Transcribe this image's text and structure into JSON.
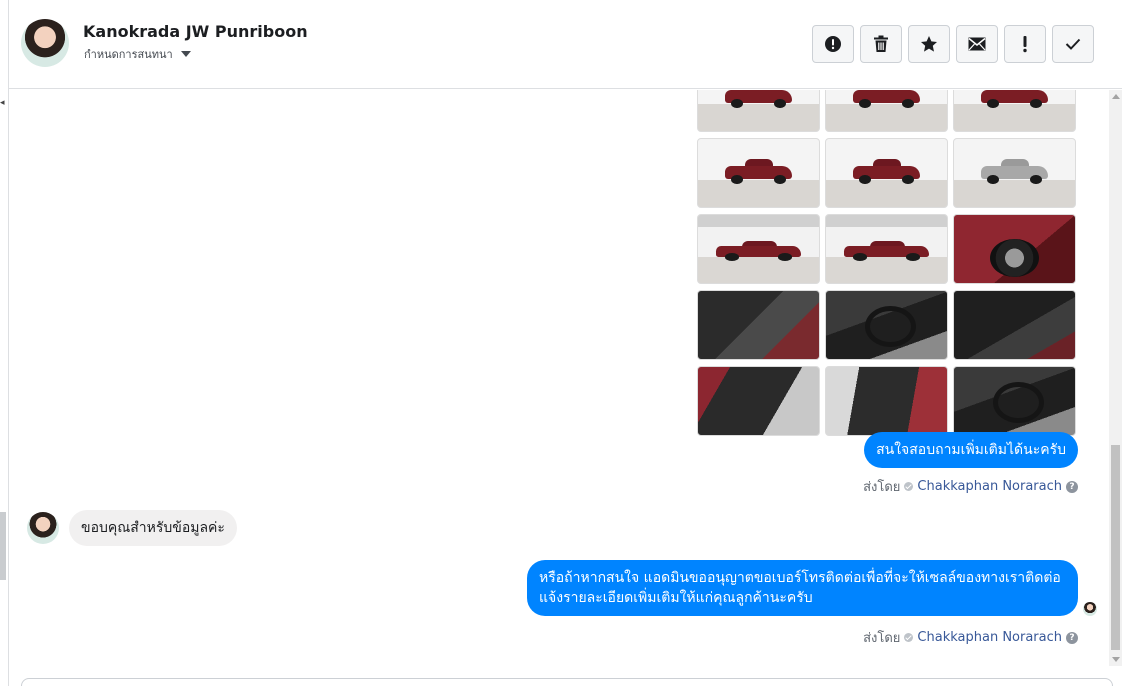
{
  "header": {
    "contact_name": "Kanokrada JW Punriboon",
    "assign_label": "กำหนดการสนทนา",
    "toolbar": [
      {
        "icon": "alert-circle-icon",
        "title": "Mark as spam"
      },
      {
        "icon": "trash-icon",
        "title": "Delete"
      },
      {
        "icon": "star-icon",
        "title": "Star"
      },
      {
        "icon": "envelope-icon",
        "title": "Mark as unread"
      },
      {
        "icon": "exclamation-icon",
        "title": "Follow up"
      },
      {
        "icon": "checkmark-icon",
        "title": "Mark as done"
      }
    ]
  },
  "photos": [
    {
      "kind": "truck-rear"
    },
    {
      "kind": "truck-rear"
    },
    {
      "kind": "truck-rear"
    },
    {
      "kind": "truck-rear"
    },
    {
      "kind": "truck-rear"
    },
    {
      "kind": "truck-rear"
    },
    {
      "kind": "truck-side"
    },
    {
      "kind": "truck-side"
    },
    {
      "kind": "wheel"
    },
    {
      "kind": "door-interior"
    },
    {
      "kind": "dashboard"
    },
    {
      "kind": "gear-shift"
    },
    {
      "kind": "seats"
    },
    {
      "kind": "seats"
    },
    {
      "kind": "dashboard"
    }
  ],
  "messages": {
    "out1": "สนใจสอบถามเพิ่มเติมได้นะครับ",
    "in1": "ขอบคุณสำหรับข้อมูลค่ะ",
    "out2": "หรือถ้าหากสนใจ แอดมินขออนุญาตขอเบอร์โทรติดต่อเพื่อที่จะให้เซลล์ของทางเราติดต่อแจ้งรายละเอียดเพิ่มเติมให้แก่คุณลูกค้านะครับ"
  },
  "sent_by": {
    "label": "ส่งโดย",
    "agent": "Chakkaphan Norarach",
    "help": "?"
  },
  "colors": {
    "outgoing_bubble": "#0084ff",
    "incoming_bubble": "#f1f0f0",
    "agent_link": "#385898"
  }
}
